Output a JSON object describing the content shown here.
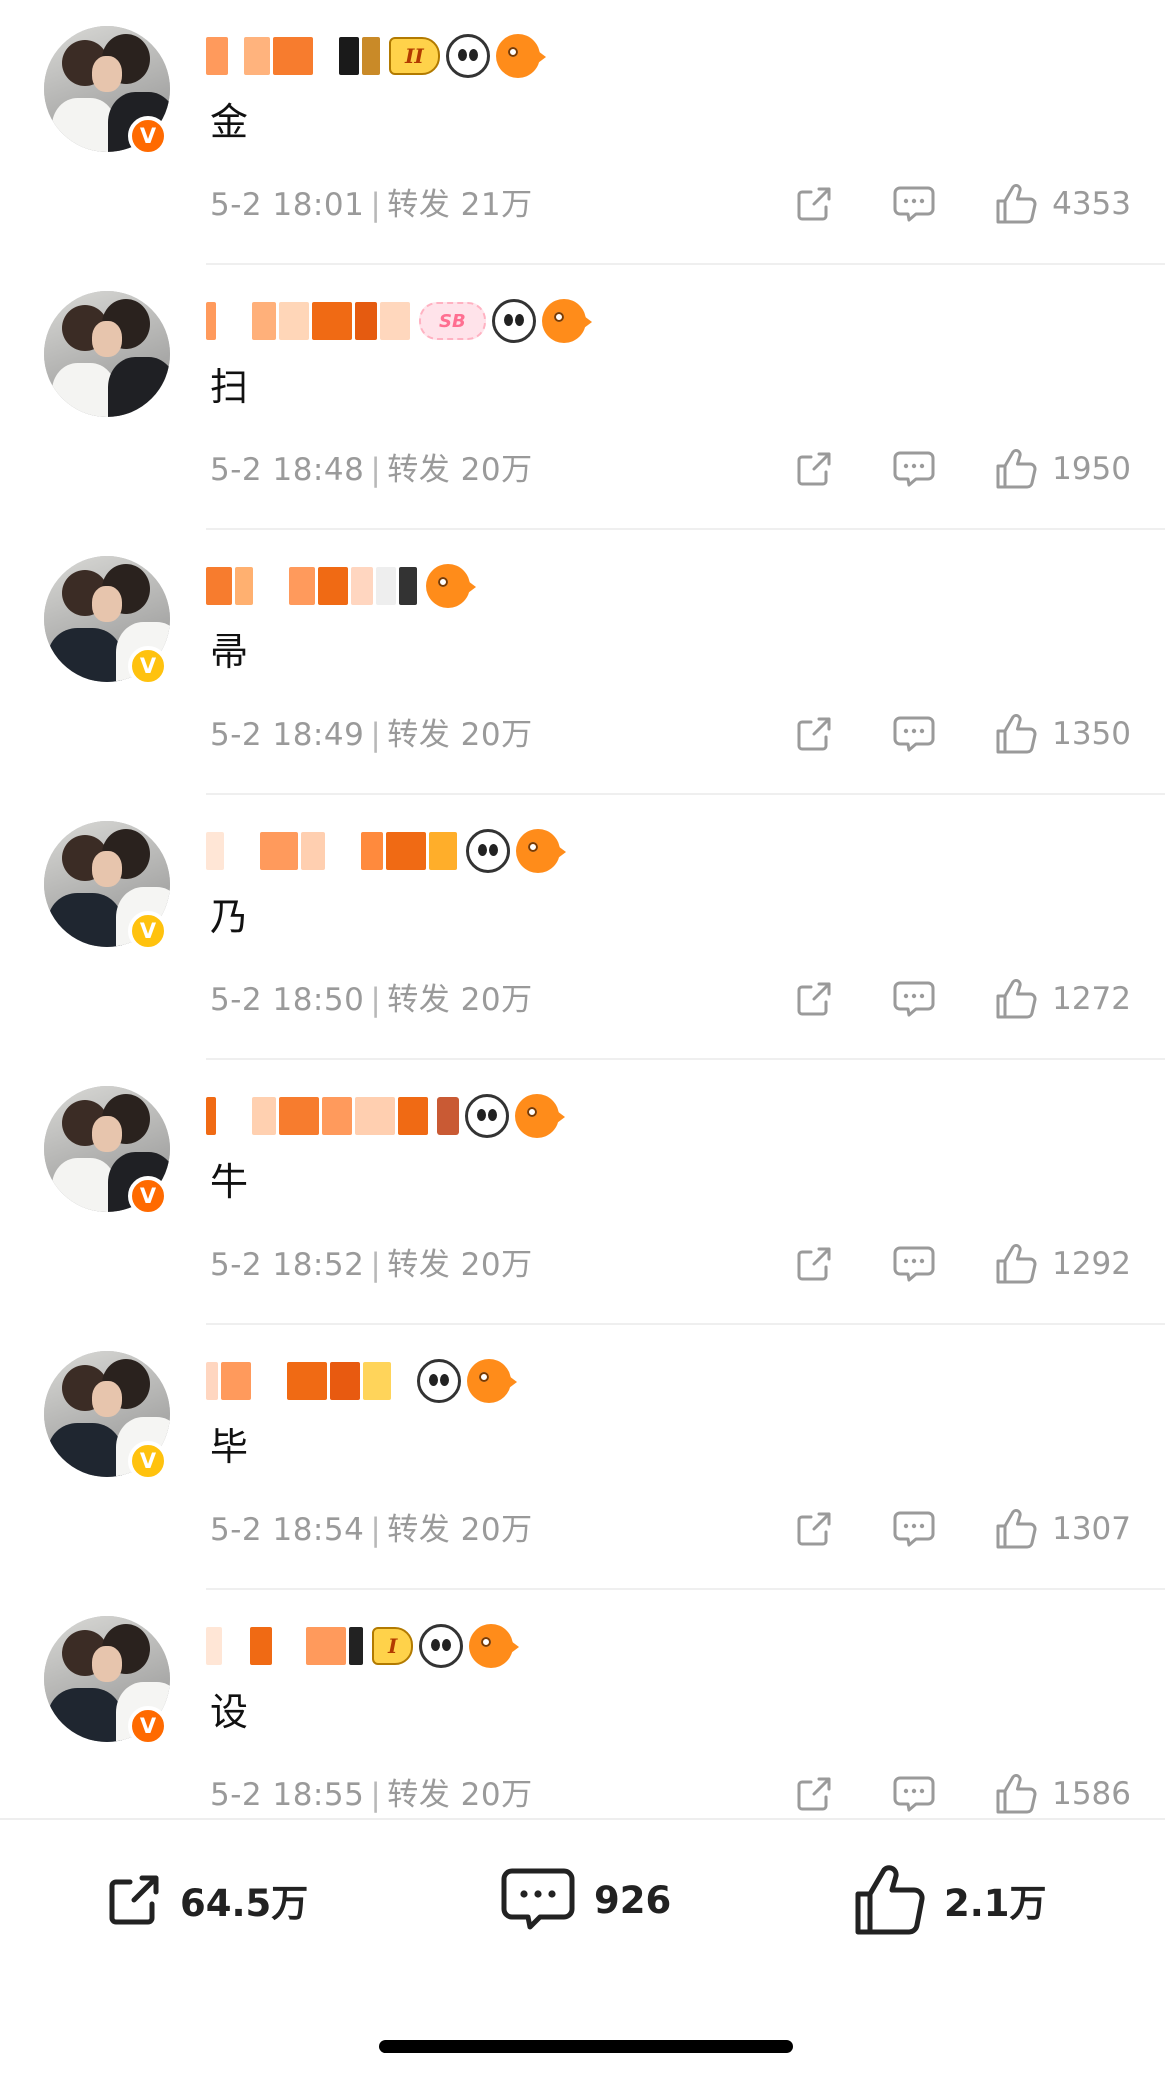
{
  "comments": [
    {
      "text": "金",
      "time": "5-2 18:01",
      "repost": "转发 21万",
      "likes": "4353",
      "badge": "V"
    },
    {
      "text": "扫",
      "time": "5-2 18:48",
      "repost": "转发 20万",
      "likes": "1950",
      "badge": ""
    },
    {
      "text": "帚",
      "time": "5-2 18:49",
      "repost": "转发 20万",
      "likes": "1350",
      "badge": "V"
    },
    {
      "text": "乃",
      "time": "5-2 18:50",
      "repost": "转发 20万",
      "likes": "1272",
      "badge": "V"
    },
    {
      "text": "牛",
      "time": "5-2 18:52",
      "repost": "转发 20万",
      "likes": "1292",
      "badge": "V"
    },
    {
      "text": "毕",
      "time": "5-2 18:54",
      "repost": "转发 20万",
      "likes": "1307",
      "badge": "V"
    },
    {
      "text": "设",
      "time": "5-2 18:55",
      "repost": "转发 20万",
      "likes": "1586",
      "badge": "V"
    }
  ],
  "user_tags": {
    "rank_1": "II",
    "pill_2": "SB",
    "rank_7": "I"
  },
  "bottom_bar": {
    "repost_count": "64.5万",
    "comment_count": "926",
    "like_count": "2.1万"
  },
  "colors": {
    "verified_orange": "#ff6a00",
    "verified_gold": "#ffc20e",
    "meta_gray": "#9a9a9a"
  },
  "icons": [
    "avatar",
    "verified-badge-icon",
    "panda-emoji-icon",
    "fish-emoji-icon",
    "share-icon",
    "comment-icon",
    "like-icon"
  ]
}
